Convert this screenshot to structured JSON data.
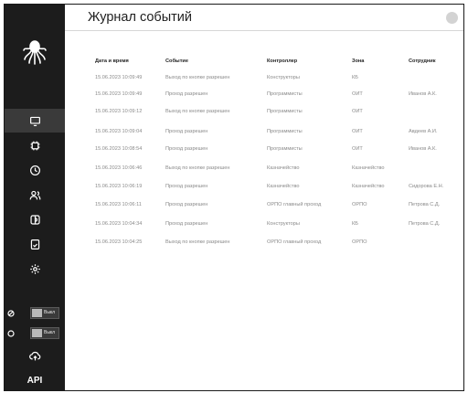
{
  "header": {
    "title": "Журнал событий"
  },
  "table": {
    "columns": [
      "Дата и время",
      "Событие",
      "Контроллер",
      "Зона",
      "Сотрудник"
    ],
    "rows": [
      [
        "15.06.2023 10:09:49",
        "Выход по кнопке разрешен",
        "Конструкторы",
        "КБ",
        ""
      ],
      [
        "15.06.2023 10:09:49",
        "Проход разрешен",
        "Программисты",
        "ОИТ",
        "Иванов А.К."
      ],
      [
        "15.06.2023 10:09:12",
        "Выход по кнопке разрешен",
        "Программисты",
        "ОИТ",
        ""
      ],
      [
        "15.06.2023 10:09:04",
        "Проход разрешен",
        "Программисты",
        "ОИТ",
        "Авдеев А.И."
      ],
      [
        "15.06.2023 10:08:54",
        "Проход разрешен",
        "Программисты",
        "ОИТ",
        "Иванов А.К."
      ],
      [
        "15.06.2023 10:06:46",
        "Выход по кнопке разрешен",
        "Казначейство",
        "Казначейство",
        ""
      ],
      [
        "15.06.2023 10:06:19",
        "Проход разрешен",
        "Казначейство",
        "Казначейство",
        "Сидорова Е.Н."
      ],
      [
        "15.06.2023 10:06:11",
        "Проход разрешен",
        "ОРПО главный проход",
        "ОРПО",
        "Петрова С.Д."
      ],
      [
        "15.06.2023 10:04:34",
        "Проход разрешен",
        "Конструкторы",
        "КБ",
        "Петрова С.Д."
      ],
      [
        "15.06.2023 10:04:25",
        "Выход по кнопке разрешен",
        "ОРПО главный проход",
        "ОРПО",
        ""
      ]
    ]
  },
  "sidebar": {
    "nav_icons": [
      "monitor-icon",
      "chip-icon",
      "clock-icon",
      "users-icon",
      "door-icon",
      "report-icon",
      "settings-icon"
    ],
    "toggles": [
      {
        "icon": "dot-icon",
        "label": "Выкл"
      },
      {
        "icon": "circle-icon",
        "label": "Выкл"
      }
    ],
    "cloud_icon": "cloud-upload-icon",
    "api_label": "API"
  },
  "colors": {
    "sidebar": "#1c1c1c",
    "active_nav": "#3a3a3a",
    "text_muted": "#8a8a8a"
  }
}
